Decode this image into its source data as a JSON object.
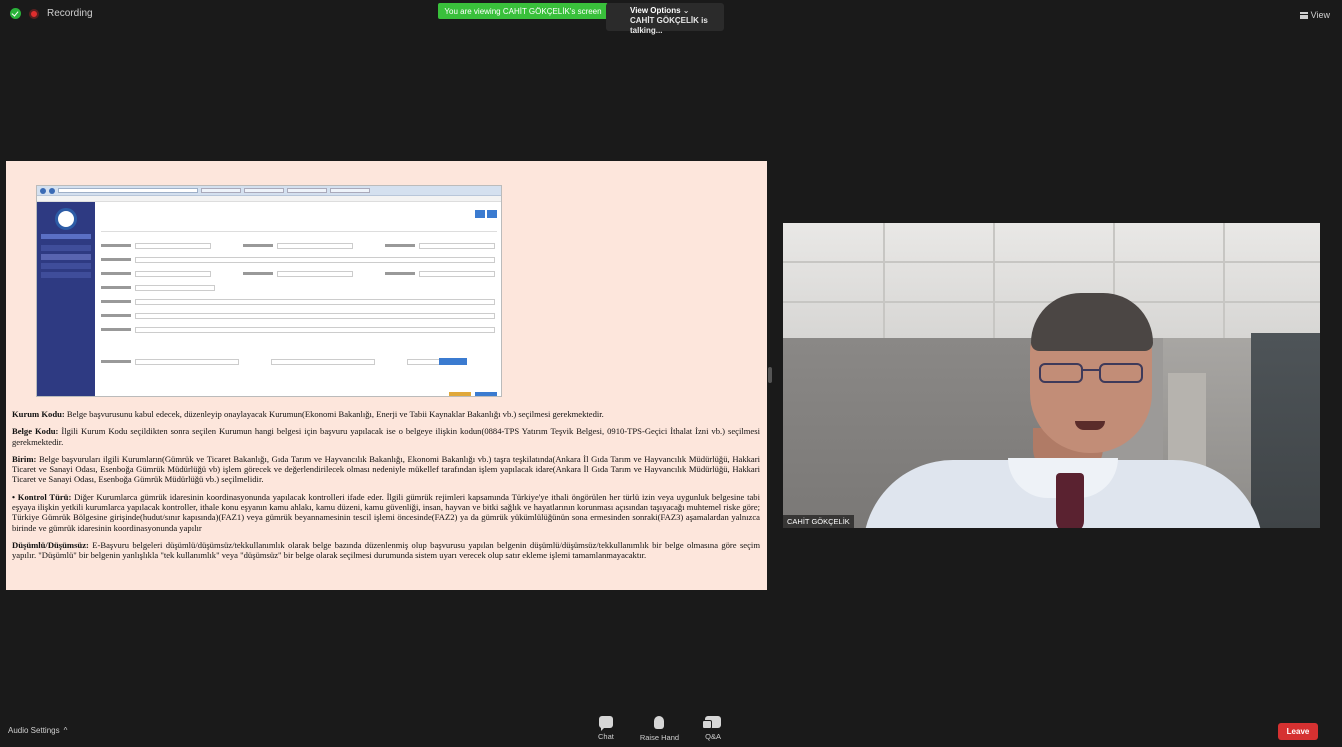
{
  "topbar": {
    "recording_label": "Recording",
    "share_banner": "You are viewing CAHİT GÖKÇELİK's screen",
    "view_options_label": "View Options",
    "view_options_caret": "⌄",
    "talking_text": "CAHİT GÖKÇELİK is talking...",
    "view_label": "View"
  },
  "shared_screen": {
    "paragraphs": [
      {
        "head": "Kurum Kodu:",
        "body": " Belge başvurusunu kabul edecek, düzenleyip onaylayacak Kurumun(Ekonomi Bakanlığı, Enerji ve Tabii Kaynaklar Bakanlığı vb.) seçilmesi gerekmektedir."
      },
      {
        "head": "Belge Kodu:",
        "body": " İlgili Kurum Kodu seçildikten sonra seçilen Kurumun hangi belgesi için başvuru yapılacak ise o belgeye ilişkin kodun(0884-TPS Yatırım Teşvik Belgesi, 0910-TPS-Geçici İthalat İzni vb.) seçilmesi gerekmektedir."
      },
      {
        "head": "Birim:",
        "body": " Belge başvuruları ilgili Kurumların(Gümrük ve Ticaret Bakanlığı, Gıda Tarım ve Hayvancılık Bakanlığı, Ekonomi Bakanlığı vb.) taşra teşkilatında(Ankara İl Gıda Tarım ve Hayvancılık Müdürlüğü, Hakkari Ticaret ve Sanayi Odası, Esenboğa Gümrük Müdürlüğü vb) işlem görecek ve değerlendirilecek olması nedeniyle mükellef tarafından işlem yapılacak idare(Ankara İl Gıda Tarım ve Hayvancılık Müdürlüğü, Hakkari Ticaret ve Sanayi Odası, Esenboğa Gümrük Müdürlüğü vb.) seçilmelidir."
      },
      {
        "head": "• Kontrol Türü:",
        "body": " Diğer Kurumlarca gümrük idaresinin koordinasyonunda yapılacak kontrolleri ifade eder. İlgili gümrük rejimleri kapsamında Türkiye'ye ithali öngörülen her türlü izin veya uygunluk belgesine tabi eşyaya ilişkin yetkili kurumlarca yapılacak kontroller, ithale konu eşyanın kamu ahlakı, kamu düzeni, kamu güvenliği, insan, hayvan ve bitki sağlık ve hayatlarının korunması açısından taşıyacağı muhtemel riske göre; Türkiye Gümrük Bölgesine girişinde(hudut/sınır kapısında)(FAZ1) veya gümrük beyannamesinin tescil işlemi öncesinde(FAZ2) ya da gümrük yükümlülüğünün sona ermesinden sonraki(FAZ3) aşamalardan yalnızca birinde ve gümrük idaresinin koordinasyonunda yapılır"
      },
      {
        "head": "Düşümlü/Düşümsüz:",
        "body": " E-Başvuru belgeleri düşümlü/düşümsüz/tekkullanımlık olarak belge bazında düzenlenmiş olup başvurusu yapılan belgenin düşümlü/düşümsüz/tekkullanımlık bir belge olmasına göre seçim yapılır. \"Düşümlü\" bir belgenin yanlışlıkla \"tek kullanımlık\" veya \"düşümsüz\" bir belge olarak seçilmesi durumunda sistem uyarı verecek olup satır ekleme işlemi tamamlanmayacaktır."
      }
    ]
  },
  "video": {
    "participant_name": "CAHİT GÖKÇELİK"
  },
  "bottombar": {
    "audio_settings": "Audio Settings",
    "audio_caret": "^",
    "chat": "Chat",
    "raise_hand": "Raise Hand",
    "qa": "Q&A",
    "leave": "Leave"
  },
  "colors": {
    "share_banner": "#39c03b",
    "leave": "#d53131",
    "shared_bg": "#fde6dc",
    "app_bg": "#1a1a1a"
  },
  "icons": [
    "shield-icon",
    "recording-icon",
    "grid-icon",
    "chat-icon",
    "raise-hand-icon",
    "qa-icon"
  ]
}
